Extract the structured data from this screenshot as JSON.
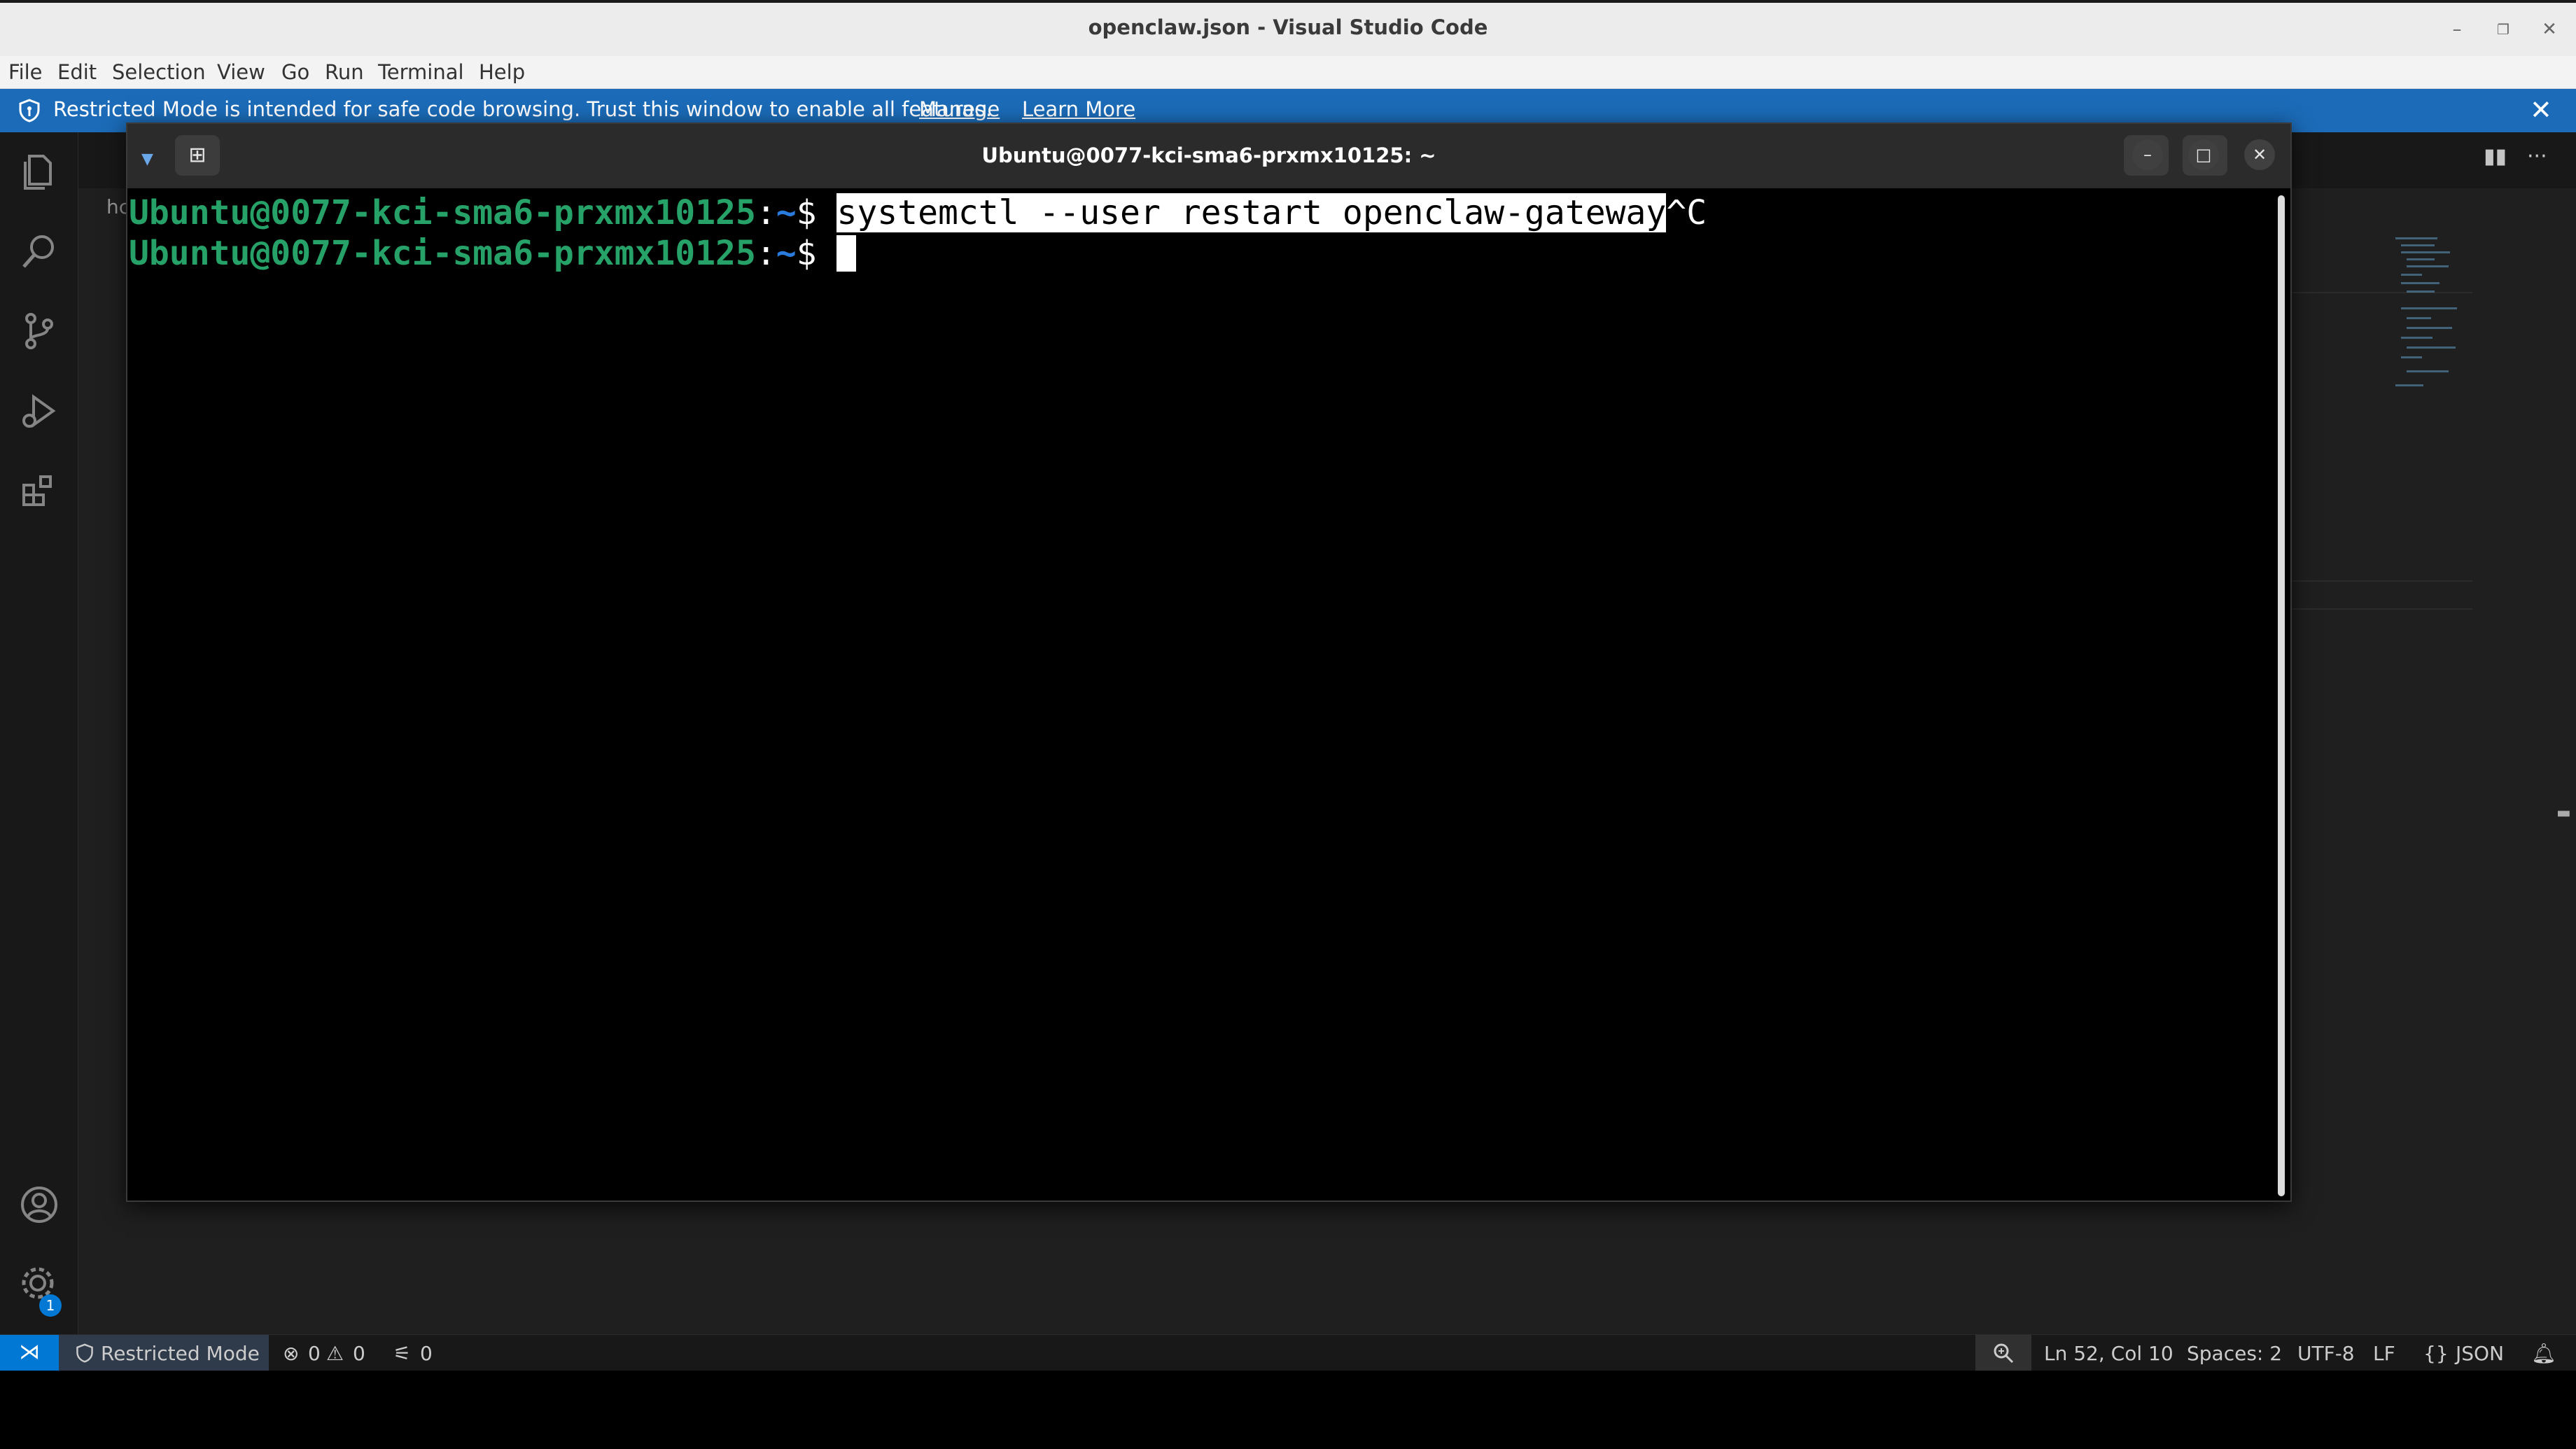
{
  "window": {
    "title": "openclaw.json - Visual Studio Code",
    "controls": {
      "minimize": "–",
      "restore": "❐",
      "close": "✕"
    }
  },
  "menu": [
    "File",
    "Edit",
    "Selection",
    "View",
    "Go",
    "Run",
    "Terminal",
    "Help"
  ],
  "banner": {
    "message": "Restricted Mode is intended for safe code browsing. Trust this window to enable all features.",
    "manage": "Manage",
    "learn_more": "Learn More",
    "close": "✕"
  },
  "activity": {
    "icons": [
      "explorer-icon",
      "search-icon",
      "source-control-icon",
      "run-debug-icon",
      "extensions-icon",
      "account-icon",
      "settings-gear-icon"
    ],
    "settings_badge": "1"
  },
  "editor": {
    "partial_tab_text": "hc",
    "split_icon": "▮▮",
    "more_icon": "···"
  },
  "terminal": {
    "title": "Ubuntu@0077-kci-sma6-prxmx10125: ~",
    "lines": [
      {
        "user": "Ubuntu@0077-kci-sma6-prxmx10125",
        "colon": ":",
        "path": "~",
        "sign": "$ ",
        "selected": "systemctl --user restart openclaw-gateway",
        "rest": "^C"
      },
      {
        "user": "Ubuntu@0077-kci-sma6-prxmx10125",
        "colon": ":",
        "path": "~",
        "sign": "$ "
      }
    ],
    "buttons": {
      "new_tab": "⊞",
      "search": "⌕",
      "menu": "≡",
      "minimize": "–",
      "maximize": "□",
      "close": "✕"
    }
  },
  "status": {
    "remote_icon": "⋊",
    "restricted_mode": "Restricted Mode",
    "errors": "0",
    "warnings": "0",
    "ports": "0",
    "ln_col": "Ln 52, Col 10",
    "spaces": "Spaces: 2",
    "encoding": "UTF-8",
    "eol": "LF",
    "language": "JSON",
    "language_icon": "{}"
  },
  "colors": {
    "banner": "#1b6bb8",
    "prompt_user": "#26a269",
    "prompt_path": "#2a7bde",
    "remote": "#0078d4"
  }
}
